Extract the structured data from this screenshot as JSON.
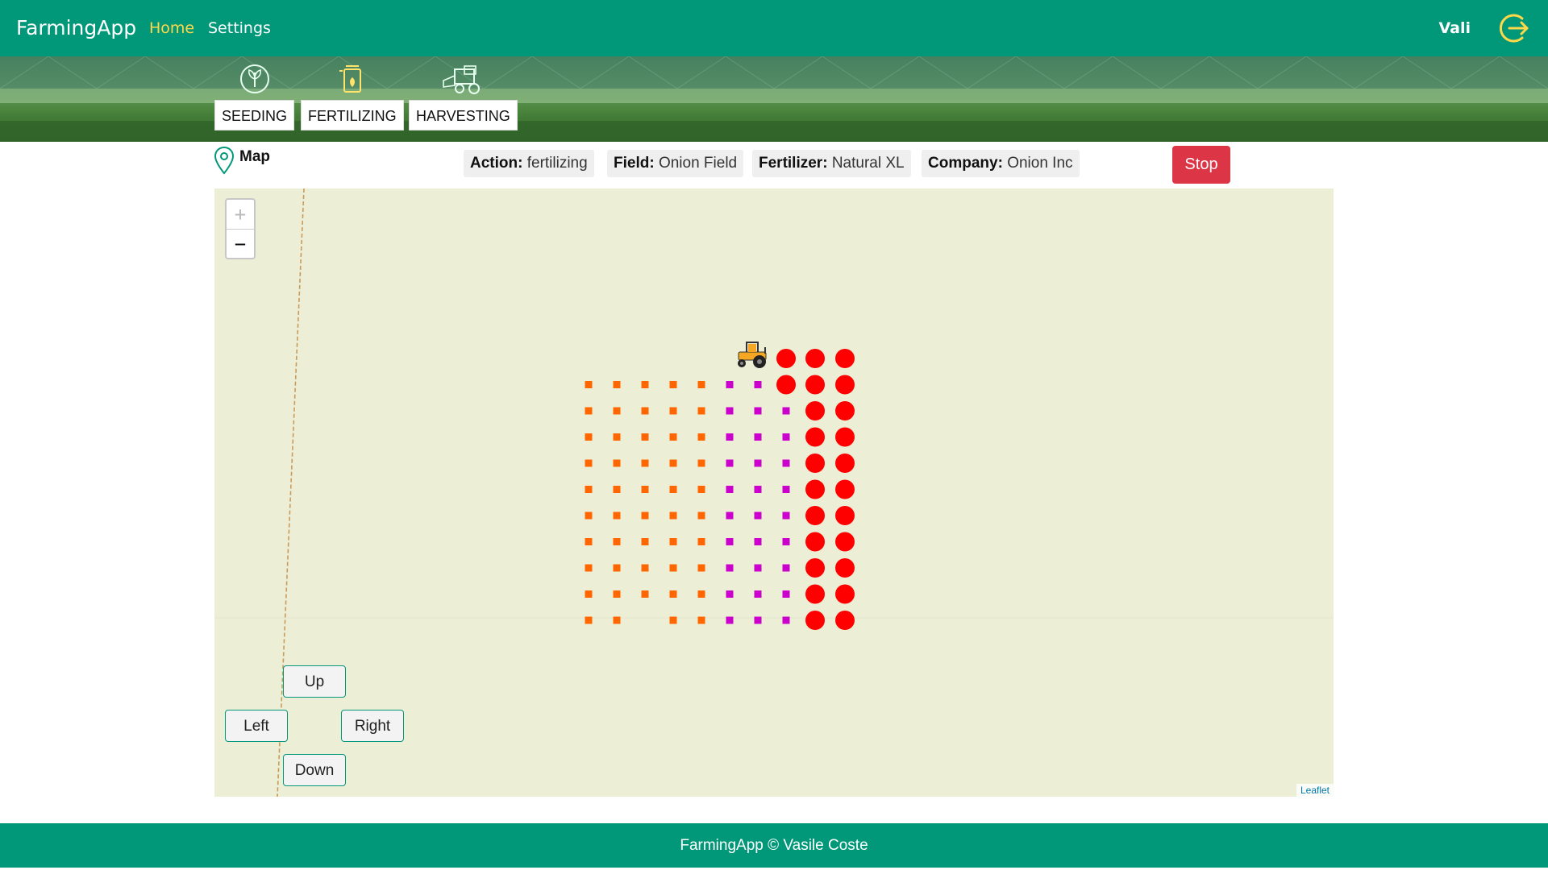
{
  "nav": {
    "brand": "FarmingApp",
    "links": [
      {
        "label": "Home",
        "active": true
      },
      {
        "label": "Settings",
        "active": false
      }
    ],
    "user": "Vali",
    "colors": {
      "bar": "#009879",
      "active": "#ffd84a"
    }
  },
  "actions": [
    {
      "label": "SEEDING",
      "icon": "seedling-icon"
    },
    {
      "label": "FERTILIZING",
      "icon": "fertilizer-icon"
    },
    {
      "label": "HARVESTING",
      "icon": "harvester-icon"
    }
  ],
  "map_title": "Map",
  "status": {
    "action_key": "Action:",
    "action": "fertilizing",
    "field_key": "Field:",
    "field": "Onion Field",
    "fertilizer_key": "Fertilizer:",
    "fertilizer": "Natural XL",
    "company_key": "Company:",
    "company": "Onion Inc"
  },
  "stop_label": "Stop",
  "map": {
    "zoom_in": "+",
    "zoom_out": "−",
    "controls": {
      "up": "Up",
      "left": "Left",
      "right": "Right",
      "down": "Down"
    },
    "attribution": "Leaflet",
    "legend_colors": {
      "seeded": "#ff6600",
      "fertilized": "#cc00cc",
      "pending": "#ff0000"
    }
  },
  "footer": "FarmingApp © Vasile Coste"
}
